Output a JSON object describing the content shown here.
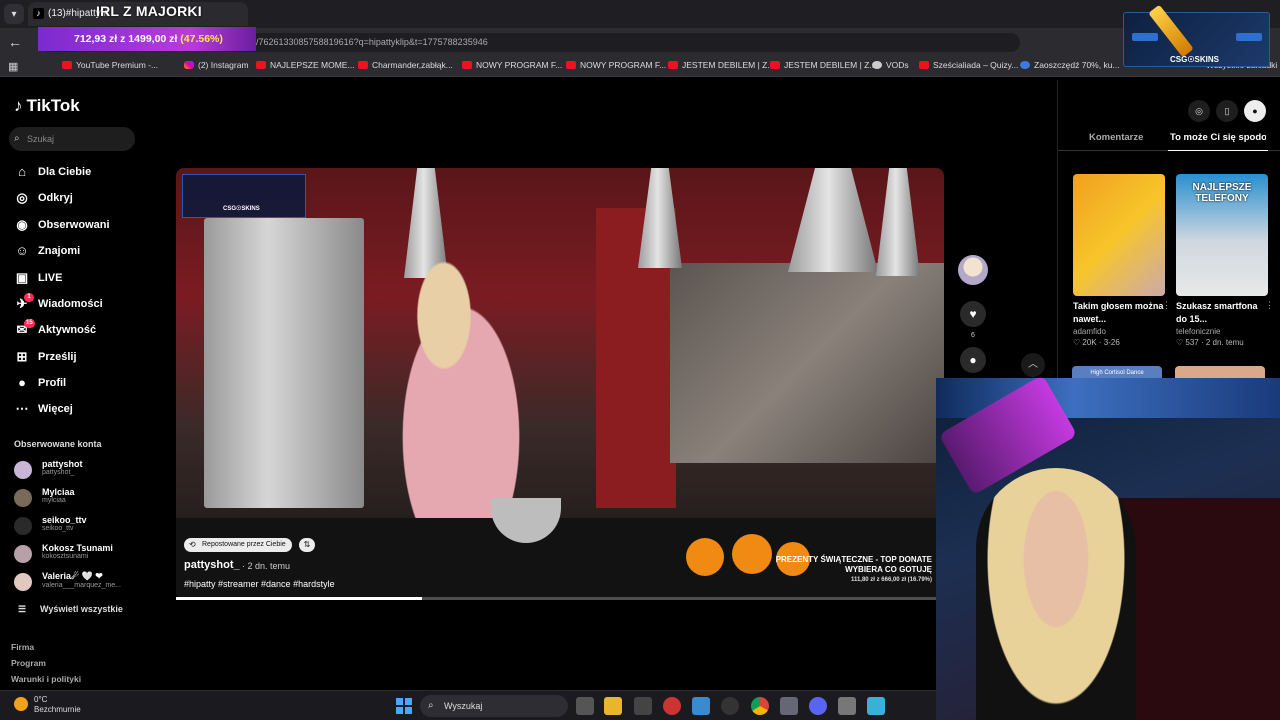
{
  "browser": {
    "tab_title": "(13)#hipatty #",
    "stream_title": "IRL Z MAJORKI",
    "url": "/7626133085758819616?q=hipattyklip&t=1775788235946",
    "donation": {
      "amount": "712,93 zł",
      "sep": "z",
      "goal": "1499,00 zł",
      "percent": "(47.56%)"
    },
    "bookmarks": [
      {
        "label": "YouTube Premium -...",
        "icon": "youtube-icon"
      },
      {
        "label": "(2) Instagram",
        "icon": "instagram-icon"
      },
      {
        "label": "NAJLEPSZE MOME...",
        "icon": "youtube-icon"
      },
      {
        "label": "Charmander,zabłąk...",
        "icon": "youtube-icon"
      },
      {
        "label": "NOWY PROGRAM F...",
        "icon": "youtube-icon"
      },
      {
        "label": "NOWY PROGRAM F...",
        "icon": "youtube-icon"
      },
      {
        "label": "JESTEM DEBILEM | Z...",
        "icon": "youtube-icon"
      },
      {
        "label": "JESTEM DEBILEM | Z...",
        "icon": "youtube-icon"
      },
      {
        "label": "VODs",
        "icon": "globe-icon"
      },
      {
        "label": "Sześcialiada – Quizy...",
        "icon": "youtube-icon"
      },
      {
        "label": "Zaoszczędź 70%, ku...",
        "icon": "steam-icon"
      }
    ],
    "all_bookmarks": "Wszystkie zakładki",
    "csg_label": "CSG☉SKINS"
  },
  "tiktok": {
    "logo": "TikTok",
    "search_placeholder": "Szukaj",
    "nav": [
      {
        "label": "Dla Ciebie",
        "icon": "home-icon",
        "glyph": "⌂"
      },
      {
        "label": "Odkryj",
        "icon": "compass-icon",
        "glyph": "◎"
      },
      {
        "label": "Obserwowani",
        "icon": "following-icon",
        "glyph": "◉"
      },
      {
        "label": "Znajomi",
        "icon": "friends-icon",
        "glyph": "☺"
      },
      {
        "label": "LIVE",
        "icon": "live-icon",
        "glyph": "▣"
      },
      {
        "label": "Wiadomości",
        "icon": "messages-icon",
        "glyph": "✈",
        "badge": "1"
      },
      {
        "label": "Aktywność",
        "icon": "activity-icon",
        "glyph": "✉",
        "badge": "15"
      },
      {
        "label": "Prześlij",
        "icon": "upload-icon",
        "glyph": "⊞"
      },
      {
        "label": "Profil",
        "icon": "profile-icon",
        "glyph": "●"
      },
      {
        "label": "Więcej",
        "icon": "more-icon",
        "glyph": "⋯"
      }
    ],
    "followed_header": "Obserwowane konta",
    "accounts": [
      {
        "name": "pattyshot",
        "handle": "pattyshot_"
      },
      {
        "name": "Mylciaa",
        "handle": "mylciaa"
      },
      {
        "name": "seikoo_ttv",
        "handle": "seikoo_ttv"
      },
      {
        "name": "Kokosz Tsunami",
        "handle": "kokosztsunami"
      },
      {
        "name": "Valeria☄ 🤍 ❤",
        "handle": "valeria___marquez_me..."
      }
    ],
    "see_all": "Wyświetl wszystkie",
    "footer": [
      "Firma",
      "Program",
      "Warunki i polityki"
    ]
  },
  "video": {
    "repost_label": "Repostowane przez Ciebie",
    "author": "pattyshot_",
    "time": "· 2 dn. temu",
    "tags": "#hipatty #streamer #dance #hardstyle",
    "overlay_title": "PREZENTY ŚWIĄTECZNE - TOP DONATE",
    "overlay_sub": "WYBIERA CO GOTUJĘ",
    "overlay_amount": "111,80 zł z 666,00 zł (16.79%)",
    "csg_label": "CSG☉SKINS",
    "progress": 0.32,
    "likes": "6"
  },
  "right_panel": {
    "tabs": [
      "Komentarze",
      "To może Ci się spodobać"
    ],
    "cards": [
      {
        "title": "Takim głosem można nawet...",
        "author": "adamfido",
        "likes": "20K",
        "date": "3-26",
        "thumb_text": ""
      },
      {
        "title": "Szukasz smartfona do 15...",
        "author": "telefonicznie",
        "likes": "537",
        "date": "2 dn. temu",
        "thumb_text": "NAJLEPSZE TELEFONY"
      }
    ],
    "next_thumb": "High Cortisol Dance"
  },
  "taskbar": {
    "temp": "0°C",
    "weather": "Bezchmurnie",
    "search": "Wyszukaj"
  }
}
